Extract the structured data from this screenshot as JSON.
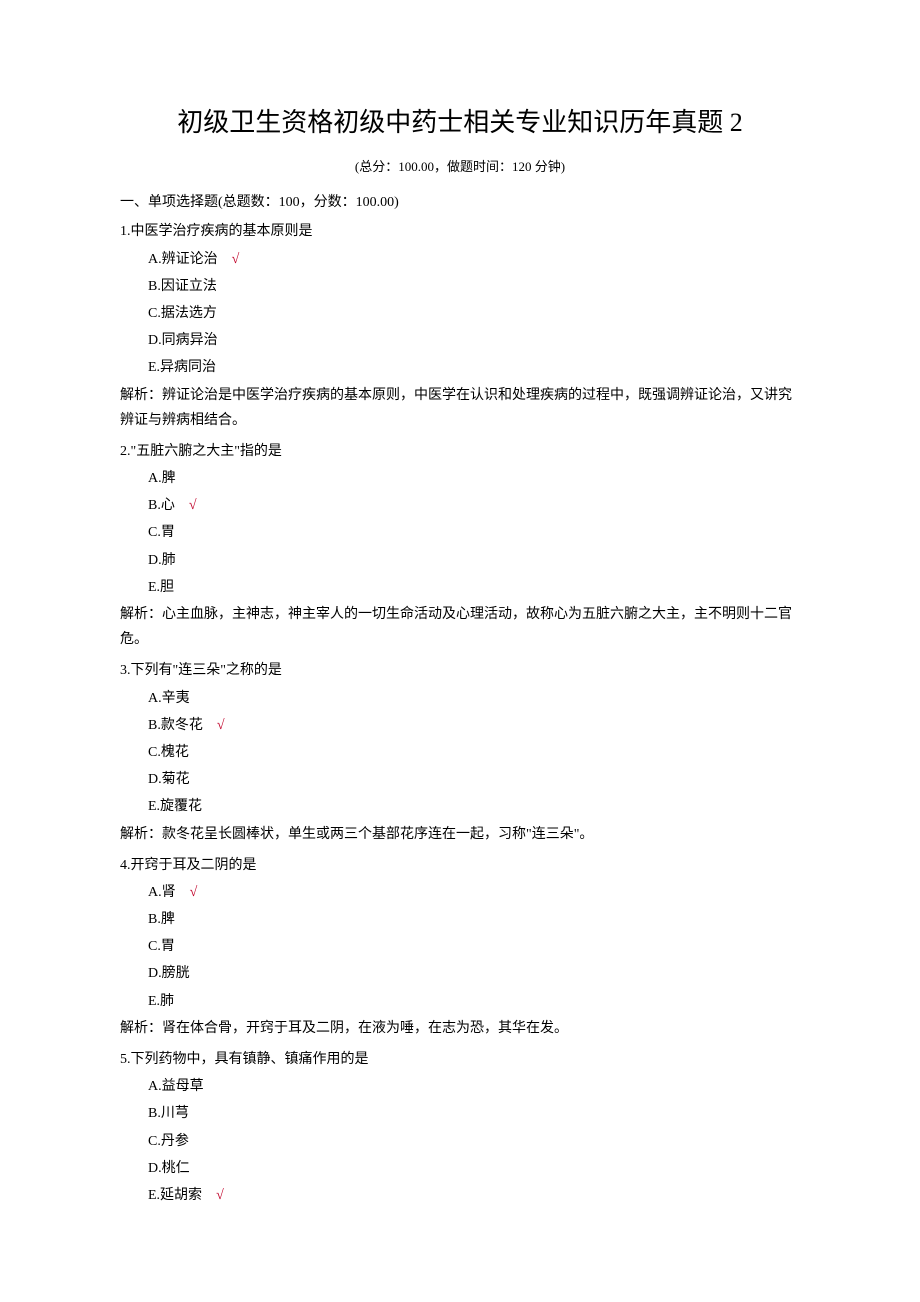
{
  "title": "初级卫生资格初级中药士相关专业知识历年真题 2",
  "meta": "(总分：100.00，做题时间：120 分钟)",
  "sectionHeading": "一、单项选择题(总题数：100，分数：100.00)",
  "checkMark": "√",
  "questions": [
    {
      "stem": "1.中医学治疗疾病的基本原则是",
      "options": [
        {
          "label": "A.辨证论治",
          "correct": true
        },
        {
          "label": "B.因证立法",
          "correct": false
        },
        {
          "label": "C.据法选方",
          "correct": false
        },
        {
          "label": "D.同病异治",
          "correct": false
        },
        {
          "label": "E.异病同治",
          "correct": false
        }
      ],
      "analysis": "解析：辨证论治是中医学治疗疾病的基本原则，中医学在认识和处理疾病的过程中，既强调辨证论治，又讲究辨证与辨病相结合。"
    },
    {
      "stem": "2.\"五脏六腑之大主\"指的是",
      "options": [
        {
          "label": "A.脾",
          "correct": false
        },
        {
          "label": "B.心",
          "correct": true
        },
        {
          "label": "C.胃",
          "correct": false
        },
        {
          "label": "D.肺",
          "correct": false
        },
        {
          "label": "E.胆",
          "correct": false
        }
      ],
      "analysis": "解析：心主血脉，主神志，神主宰人的一切生命活动及心理活动，故称心为五脏六腑之大主，主不明则十二官危。"
    },
    {
      "stem": "3.下列有\"连三朵\"之称的是",
      "options": [
        {
          "label": "A.辛夷",
          "correct": false
        },
        {
          "label": "B.款冬花",
          "correct": true
        },
        {
          "label": "C.槐花",
          "correct": false
        },
        {
          "label": "D.菊花",
          "correct": false
        },
        {
          "label": "E.旋覆花",
          "correct": false
        }
      ],
      "analysis": "解析：款冬花呈长圆棒状，单生或两三个基部花序连在一起，习称\"连三朵\"。"
    },
    {
      "stem": "4.开窍于耳及二阴的是",
      "options": [
        {
          "label": "A.肾",
          "correct": true
        },
        {
          "label": "B.脾",
          "correct": false
        },
        {
          "label": "C.胃",
          "correct": false
        },
        {
          "label": "D.膀胱",
          "correct": false
        },
        {
          "label": "E.肺",
          "correct": false
        }
      ],
      "analysis": "解析：肾在体合骨，开窍于耳及二阴，在液为唾，在志为恐，其华在发。"
    },
    {
      "stem": "5.下列药物中，具有镇静、镇痛作用的是",
      "options": [
        {
          "label": "A.益母草",
          "correct": false
        },
        {
          "label": "B.川芎",
          "correct": false
        },
        {
          "label": "C.丹参",
          "correct": false
        },
        {
          "label": "D.桃仁",
          "correct": false
        },
        {
          "label": "E.延胡索",
          "correct": true
        }
      ],
      "analysis": ""
    }
  ]
}
